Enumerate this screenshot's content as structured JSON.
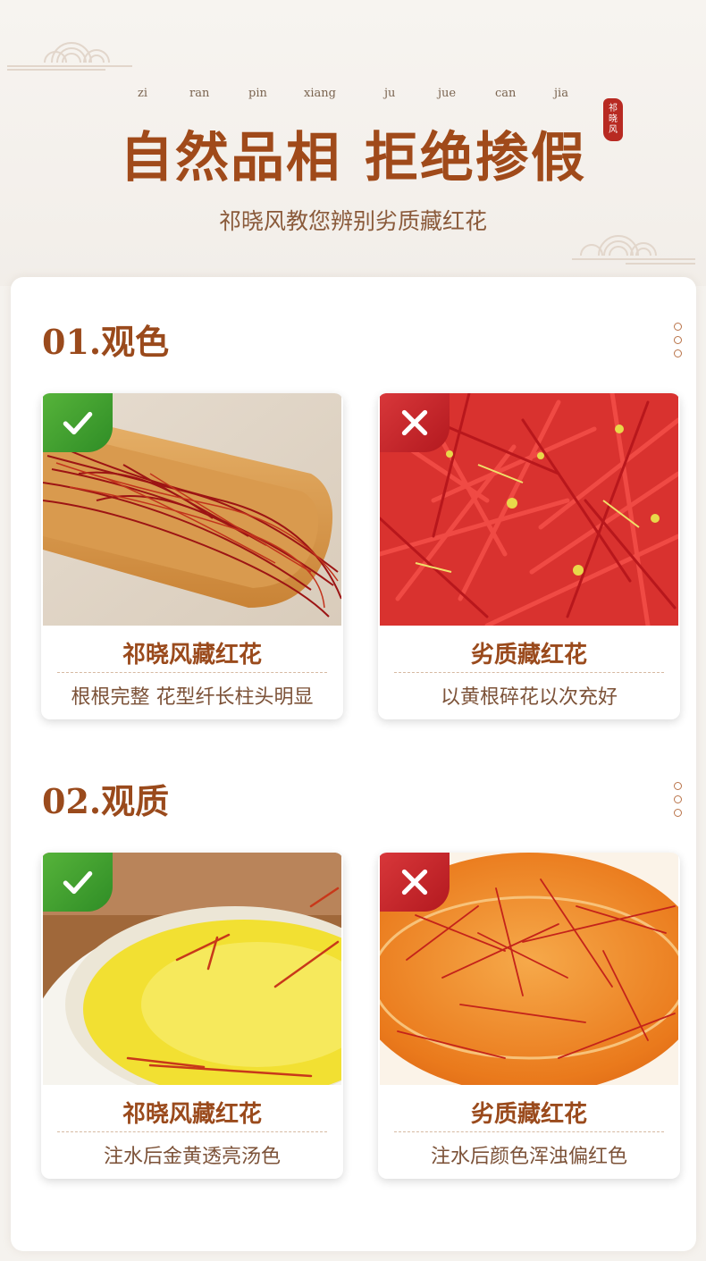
{
  "header": {
    "pinyin": [
      "zi",
      "ran",
      "pin",
      "xiang",
      "ju",
      "jue",
      "can",
      "jia"
    ],
    "title_part1": "自然品相",
    "title_part2": "拒绝掺假",
    "seal_text": [
      "祁",
      "晓",
      "风"
    ],
    "subtitle": "祁晓风教您辨别劣质藏红花"
  },
  "sections": [
    {
      "title": "01.观色",
      "cards": [
        {
          "status": "good",
          "name": "祁晓风藏红花",
          "desc": "根根完整 花型纤长柱头明显"
        },
        {
          "status": "bad",
          "name": "劣质藏红花",
          "desc": "以黄根碎花以次充好"
        }
      ]
    },
    {
      "title": "02.观质",
      "cards": [
        {
          "status": "good",
          "name": "祁晓风藏红花",
          "desc": "注水后金黄透亮汤色"
        },
        {
          "status": "bad",
          "name": "劣质藏红花",
          "desc": "注水后颜色浑浊偏红色"
        }
      ]
    }
  ],
  "colors": {
    "accent": "#9a4a1c",
    "title": "#a04a1a",
    "good": "#3a9a2c",
    "bad": "#c3232a"
  },
  "icons": {
    "good": "check-icon",
    "bad": "cross-icon",
    "menu": "vertical-dots-icon"
  }
}
